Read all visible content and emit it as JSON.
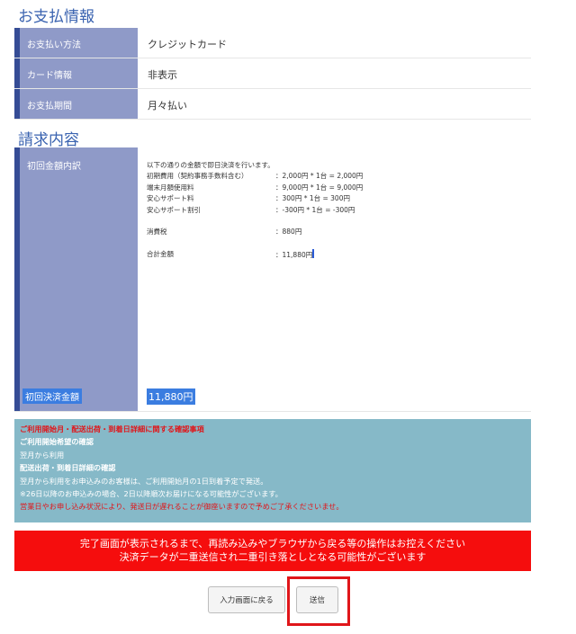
{
  "payment_section": {
    "title": "お支払情報",
    "rows": [
      {
        "label": "お支払い方法",
        "value": "クレジットカード"
      },
      {
        "label": "カード情報",
        "value": "非表示"
      },
      {
        "label": "お支払期間",
        "value": "月々払い"
      }
    ]
  },
  "billing_section": {
    "title": "請求内容",
    "initial_label": "初回金額内訳",
    "intro": "以下の通りの金額で即日決済を行います。",
    "lines": [
      {
        "key": "初期費用（契約事務手数料含む）",
        "value": "：2,000円 * 1台 = 2,000円"
      },
      {
        "key": "端末月額使用料",
        "value": "：9,000円 * 1台 = 9,000円"
      },
      {
        "key": "安心サポート料",
        "value": "：300円 * 1台 = 300円"
      },
      {
        "key": "安心サポート割引",
        "value": "：-300円 * 1台 = -300円"
      }
    ],
    "tax": {
      "key": "消費税",
      "value": "：880円"
    },
    "sum": {
      "key": "合計金額",
      "value": "：11,880円"
    },
    "total_label": "初回決済金額",
    "total_value": "11,880円"
  },
  "notice": {
    "heading": "ご利用開始月・配送出荷・到着日詳細に関する確認事項",
    "sub1": "ご利用開始希望の確認",
    "text1": "翌月から利用",
    "sub2": "配送出荷・到着日詳細の確認",
    "text2": "翌月から利用をお申込みのお客様は、ご利用開始月の1日到着予定で発送。",
    "text3": "※26日以降のお申込みの場合、2日以降順次お届けになる可能性がございます。",
    "text4": "営業日やお申し込み状況により、発送日が遅れることが御座いますので予めご了承くださいませ。"
  },
  "warning": {
    "line1": "完了画面が表示されるまで、再読み込みやブラウザから戻る等の操作はお控えください",
    "line2": "決済データが二重送信され二重引き落としとなる可能性がございます"
  },
  "buttons": {
    "back": "入力画面に戻る",
    "submit": "送信"
  },
  "colors": {
    "title_blue": "#3a63b0",
    "label_bg": "#8f9ac8",
    "label_border": "#354c95",
    "notice_bg": "#86b9c8",
    "warning_bg": "#f50d0d",
    "selection_blue": "#3b7de0"
  }
}
